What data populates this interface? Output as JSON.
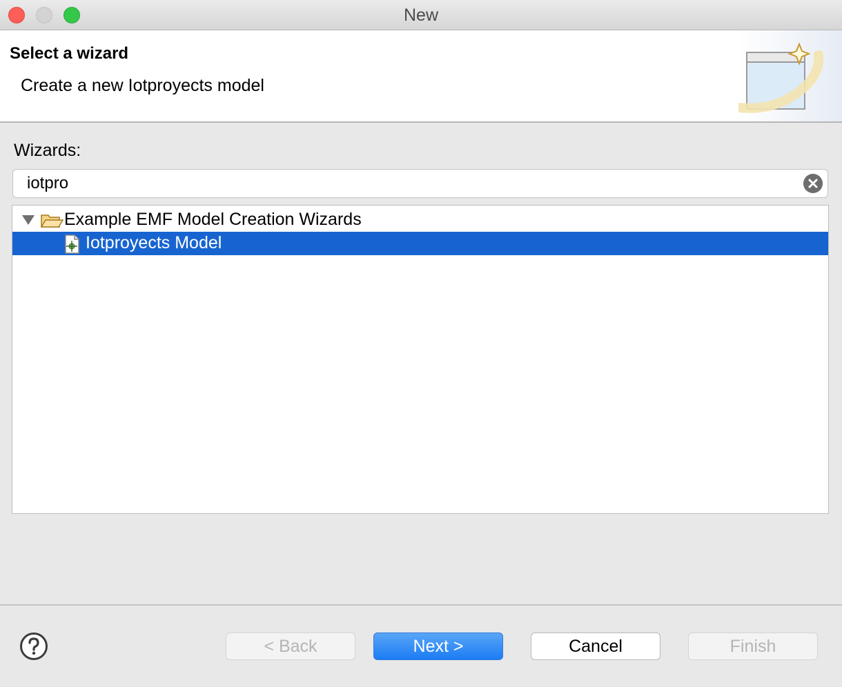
{
  "window": {
    "title": "New"
  },
  "banner": {
    "title": "Select a wizard",
    "description": "Create a new Iotproyects model",
    "image_icon": "new-wizard-banner-icon"
  },
  "wizards": {
    "label": "Wizards:",
    "filter_value": "iotpro",
    "clear_icon": "clear-icon"
  },
  "tree": {
    "items": [
      {
        "label": "Example EMF Model Creation Wizards",
        "icon": "folder-open-icon",
        "expanded": true,
        "selected": false
      },
      {
        "label": "Iotproyects Model",
        "icon": "emf-model-icon",
        "selected": true
      }
    ]
  },
  "buttons": {
    "back": "< Back",
    "next": "Next >",
    "cancel": "Cancel",
    "finish": "Finish"
  },
  "colors": {
    "selection": "#1764d1",
    "primary_button": "#1b7cf3",
    "close": "#fc5f57",
    "maximize": "#34c84a"
  }
}
